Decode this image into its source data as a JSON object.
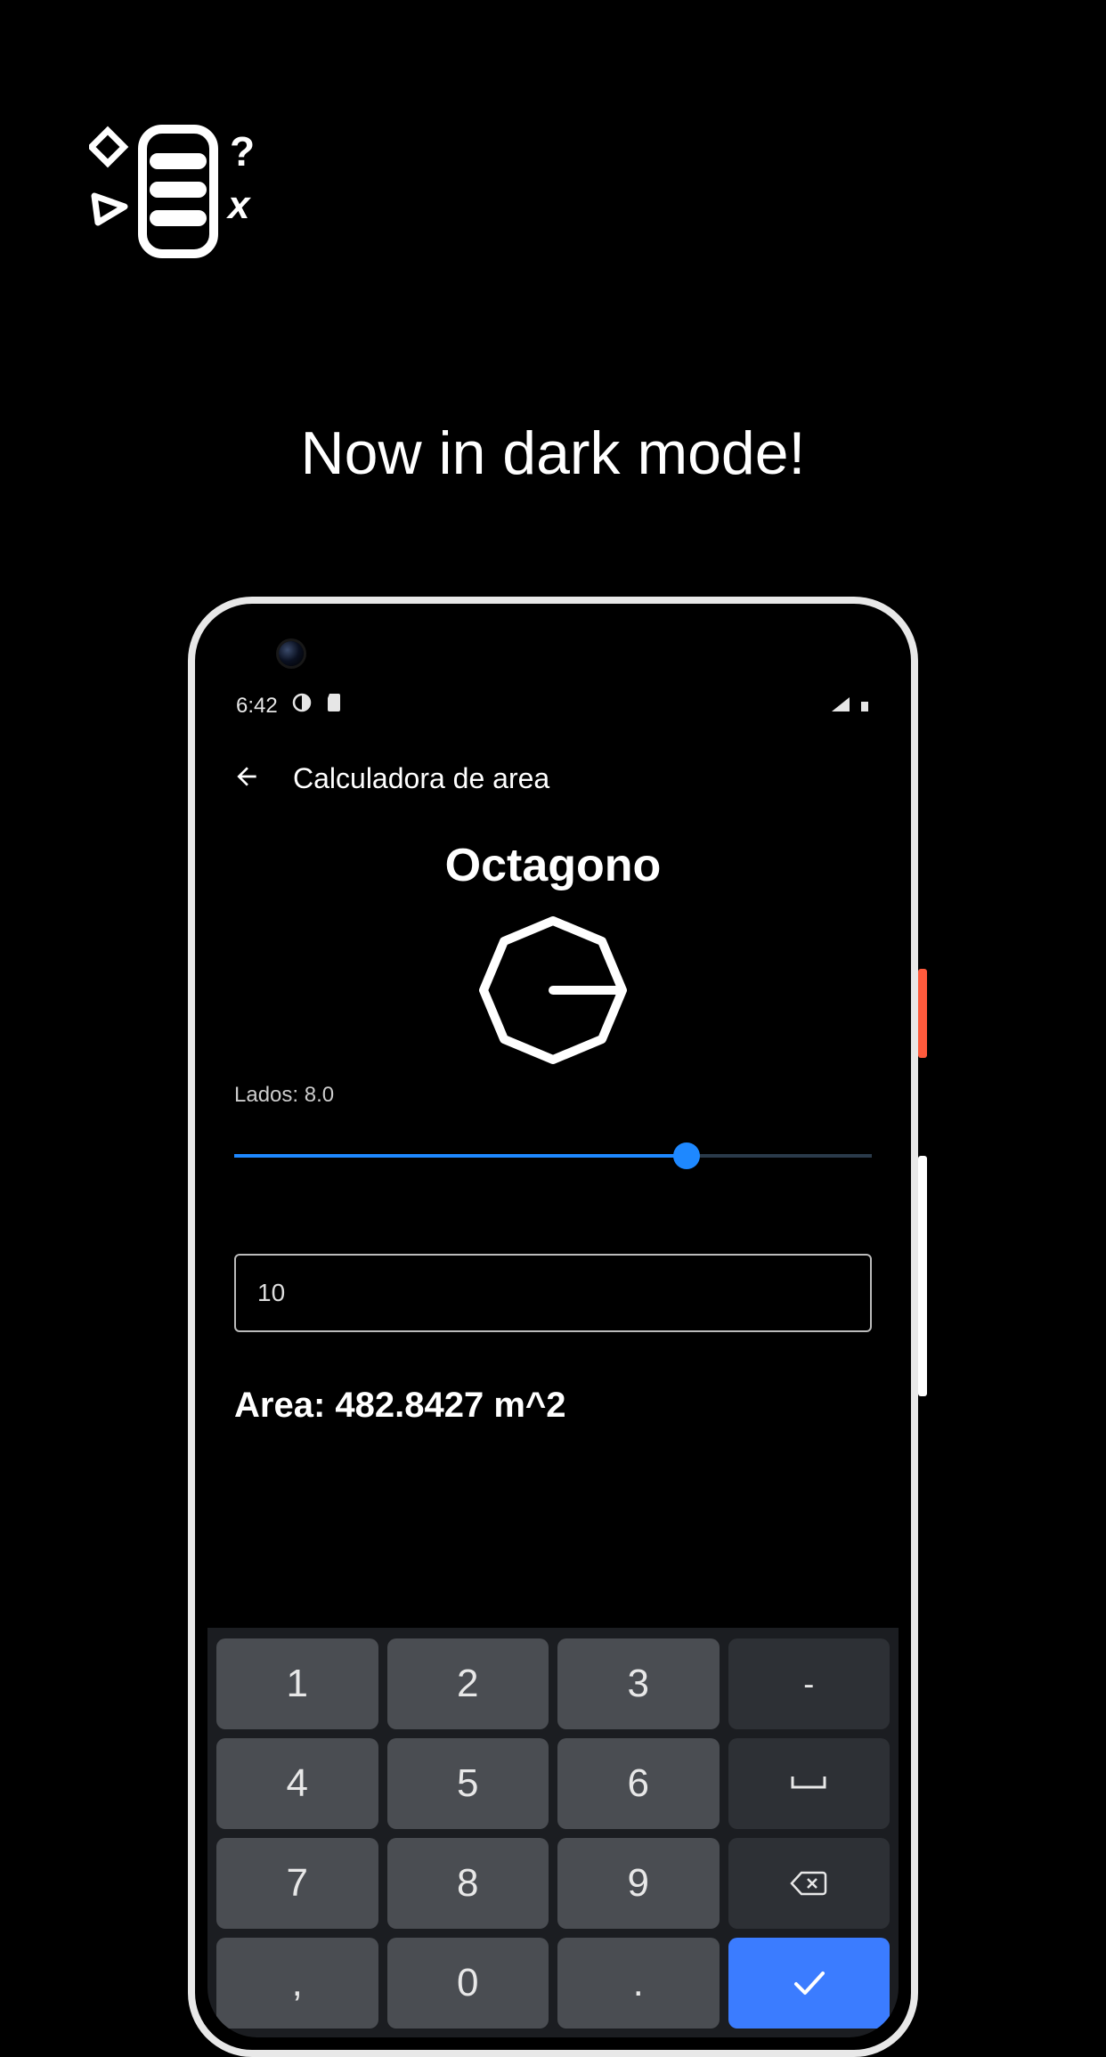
{
  "headline": "Now in dark mode!",
  "statusBar": {
    "time": "6:42"
  },
  "appBar": {
    "title": "Calculadora de area"
  },
  "shape": {
    "name": "Octagono"
  },
  "sides": {
    "label": "Lados: 8.0",
    "value": 8.0,
    "max": 10
  },
  "input": {
    "value": "10"
  },
  "result": {
    "text": "Area: 482.8427 m^2"
  },
  "keyboard": {
    "rows": [
      [
        "1",
        "2",
        "3",
        "-"
      ],
      [
        "4",
        "5",
        "6",
        "␣"
      ],
      [
        "7",
        "8",
        "9",
        "⌫"
      ],
      [
        ",",
        "0",
        ".",
        "✓"
      ]
    ]
  },
  "colors": {
    "accent": "#1e88ff",
    "enter": "#3b7cff"
  }
}
